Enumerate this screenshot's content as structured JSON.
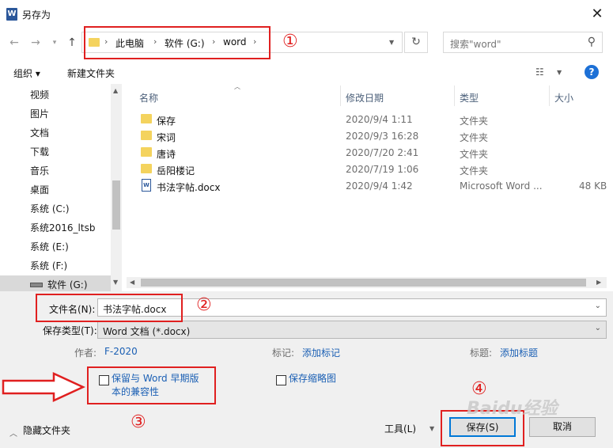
{
  "window": {
    "title": "另存为",
    "icon_letter": "W"
  },
  "address": {
    "crumbs": [
      "此电脑",
      "软件 (G:)",
      "word"
    ]
  },
  "search": {
    "placeholder": "搜索\"word\""
  },
  "toolbar": {
    "organize_label": "组织 ▾",
    "new_folder_label": "新建文件夹",
    "help_label": "?"
  },
  "sidebar": {
    "items": [
      {
        "label": "视频",
        "icon": "video-icon"
      },
      {
        "label": "图片",
        "icon": "picture-icon"
      },
      {
        "label": "文档",
        "icon": "document-icon"
      },
      {
        "label": "下载",
        "icon": "download-icon"
      },
      {
        "label": "音乐",
        "icon": "music-icon"
      },
      {
        "label": "桌面",
        "icon": "desktop-icon"
      },
      {
        "label": "系统 (C:)",
        "icon": "drive-icon"
      },
      {
        "label": "系统2016_ltsb",
        "icon": "drive-icon"
      },
      {
        "label": "系统 (E:)",
        "icon": "drive-icon"
      },
      {
        "label": "系统 (F:)",
        "icon": "drive-icon"
      },
      {
        "label": "软件 (G:)",
        "icon": "drive-icon",
        "selected": true
      }
    ]
  },
  "filelist": {
    "columns": [
      "名称",
      "修改日期",
      "类型",
      "大小"
    ],
    "rows": [
      {
        "name": "保存",
        "date": "2020/9/4 1:11",
        "type": "文件夹",
        "size": "",
        "kind": "folder"
      },
      {
        "name": "宋词",
        "date": "2020/9/3 16:28",
        "type": "文件夹",
        "size": "",
        "kind": "folder"
      },
      {
        "name": "唐诗",
        "date": "2020/7/20 2:41",
        "type": "文件夹",
        "size": "",
        "kind": "folder"
      },
      {
        "name": "岳阳楼记",
        "date": "2020/7/19 1:06",
        "type": "文件夹",
        "size": "",
        "kind": "folder"
      },
      {
        "name": "书法字帖.docx",
        "date": "2020/9/4 1:42",
        "type": "Microsoft Word ...",
        "size": "48 KB",
        "kind": "word"
      }
    ]
  },
  "form": {
    "filename_label": "文件名(N):",
    "filename_value": "书法字帖.docx",
    "filetype_label": "保存类型(T):",
    "filetype_value": "Word 文档 (*.docx)",
    "author_label": "作者:",
    "author_value": "F-2020",
    "tags_label": "标记:",
    "tags_value": "添加标记",
    "title_label": "标题:",
    "title_value": "添加标题",
    "compat_checkbox_label_line1": "保留与 Word 早期版",
    "compat_checkbox_label_line2": "本的兼容性",
    "thumbnail_checkbox_label": "保存缩略图"
  },
  "footer": {
    "hide_folders_label": "隐藏文件夹",
    "tools_label": "工具(L)",
    "save_label": "保存(S)",
    "cancel_label": "取消"
  },
  "annotations": {
    "marker_1": "①",
    "marker_2": "②",
    "marker_3": "③",
    "marker_4": "④"
  },
  "watermark": "Baidu经验",
  "colors": {
    "accent": "#0078d7",
    "annotation_red": "#e02020",
    "link_blue": "#1a5fb4",
    "folder_yellow": "#f4d35e"
  }
}
